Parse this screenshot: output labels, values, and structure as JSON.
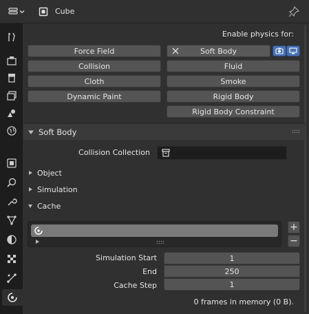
{
  "header": {
    "object_name": "Cube"
  },
  "physics": {
    "enable_label": "Enable physics for:",
    "buttons": {
      "force_field": "Force Field",
      "soft_body": "Soft Body",
      "collision": "Collision",
      "fluid": "Fluid",
      "cloth": "Cloth",
      "smoke": "Smoke",
      "dynamic_paint": "Dynamic Paint",
      "rigid_body": "Rigid Body",
      "rigid_body_constraint": "Rigid Body Constraint"
    }
  },
  "soft_body": {
    "title": "Soft Body",
    "collision_collection_label": "Collision Collection",
    "collision_collection_value": "",
    "subpanels": {
      "object": "Object",
      "simulation": "Simulation",
      "cache": "Cache"
    }
  },
  "cache": {
    "simulation_start_label": "Simulation Start",
    "simulation_start_value": "1",
    "end_label": "End",
    "end_value": "250",
    "cache_step_label": "Cache Step",
    "cache_step_value": "1",
    "memory_text": "0 frames in memory (0 B).",
    "add_label": "+",
    "remove_label": "−"
  },
  "colors": {
    "accent": "#4772b3",
    "panel_bg": "#303030",
    "button_bg": "#545454"
  }
}
